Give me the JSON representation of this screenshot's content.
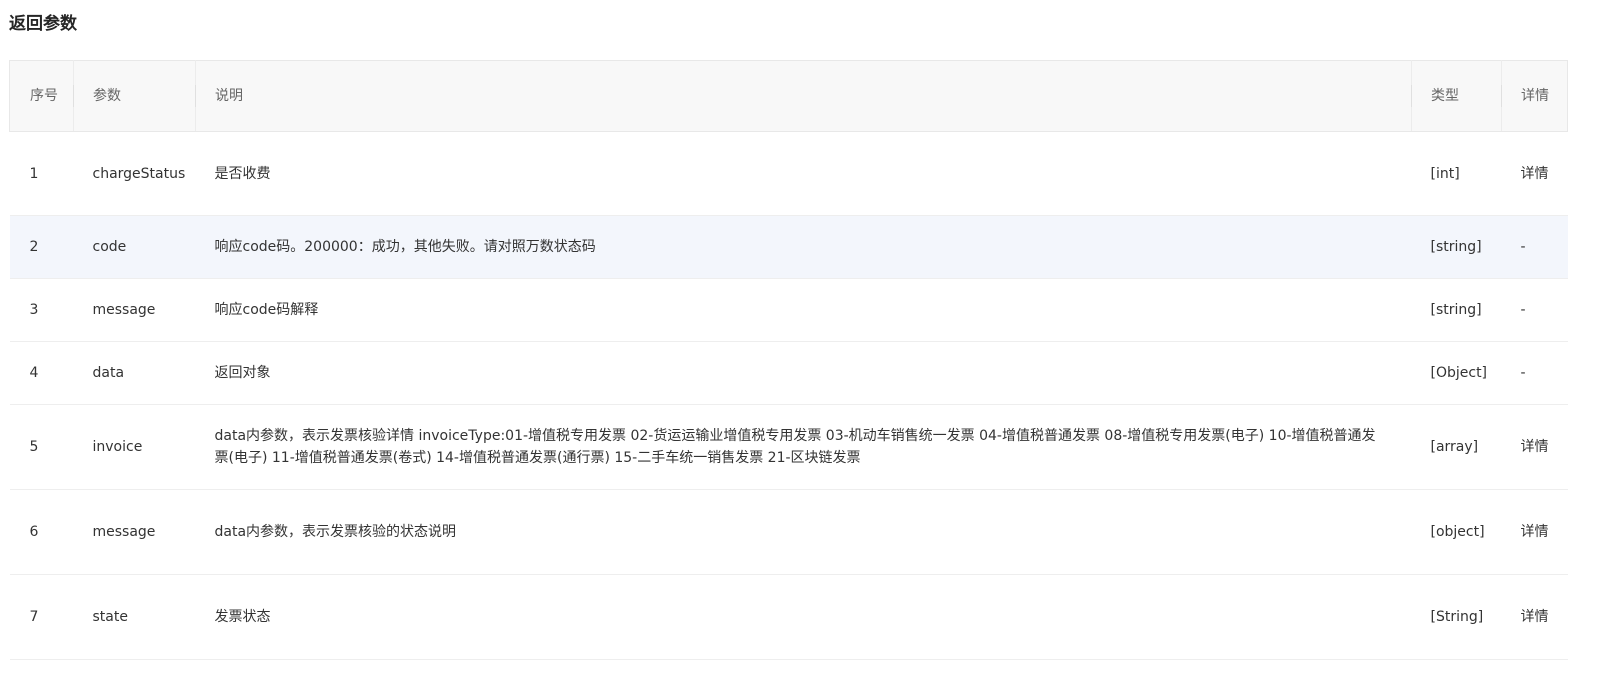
{
  "section": {
    "title": "返回参数"
  },
  "table": {
    "headers": {
      "index": "序号",
      "param": "参数",
      "description": "说明",
      "type": "类型",
      "detail": "详情"
    },
    "rows": [
      {
        "index": "1",
        "param": "chargeStatus",
        "description": "是否收费",
        "type": "[int]",
        "detail": "详情"
      },
      {
        "index": "2",
        "param": "code",
        "description": "响应code码。200000：成功，其他失败。请对照万数状态码",
        "type": "[string]",
        "detail": "-"
      },
      {
        "index": "3",
        "param": "message",
        "description": "响应code码解释",
        "type": "[string]",
        "detail": "-"
      },
      {
        "index": "4",
        "param": "data",
        "description": "返回对象",
        "type": "[Object]",
        "detail": "-"
      },
      {
        "index": "5",
        "param": "invoice",
        "description": "data内参数，表示发票核验详情 invoiceType:01-增值税专用发票 02-货运运输业增值税专用发票 03-机动车销售统一发票 04-增值税普通发票 08-增值税专用发票(电子) 10-增值税普通发票(电子) 11-增值税普通发票(卷式) 14-增值税普通发票(通行票) 15-二手车统一销售发票 21-区块链发票",
        "type": "[array]",
        "detail": "详情"
      },
      {
        "index": "6",
        "param": "message",
        "description": "data内参数，表示发票核验的状态说明",
        "type": "[object]",
        "detail": "详情"
      },
      {
        "index": "7",
        "param": "state",
        "description": "发票状态",
        "type": "[String]",
        "detail": "详情"
      }
    ],
    "highlighted_row": "2"
  }
}
